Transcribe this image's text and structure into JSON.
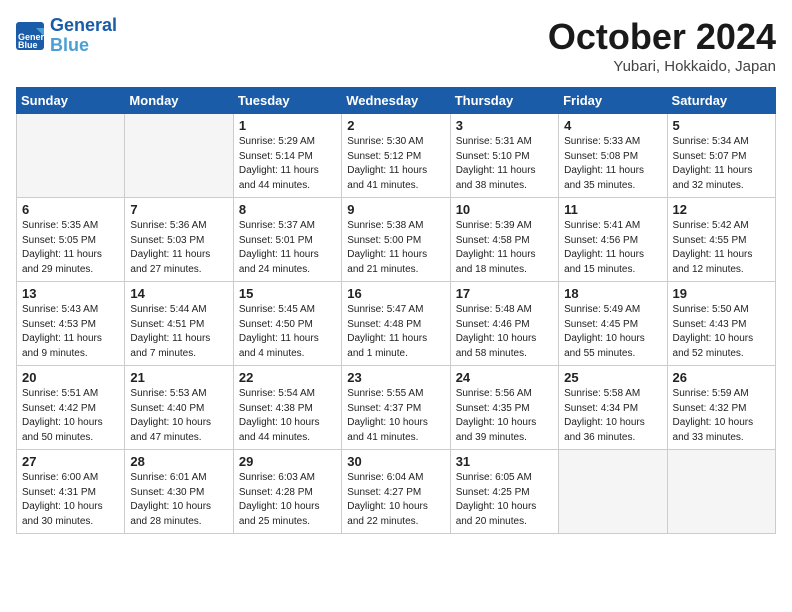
{
  "header": {
    "logo_line1": "General",
    "logo_line2": "Blue",
    "title": "October 2024",
    "subtitle": "Yubari, Hokkaido, Japan"
  },
  "weekdays": [
    "Sunday",
    "Monday",
    "Tuesday",
    "Wednesday",
    "Thursday",
    "Friday",
    "Saturday"
  ],
  "weeks": [
    [
      {
        "day": "",
        "info": ""
      },
      {
        "day": "",
        "info": ""
      },
      {
        "day": "1",
        "info": "Sunrise: 5:29 AM\nSunset: 5:14 PM\nDaylight: 11 hours\nand 44 minutes."
      },
      {
        "day": "2",
        "info": "Sunrise: 5:30 AM\nSunset: 5:12 PM\nDaylight: 11 hours\nand 41 minutes."
      },
      {
        "day": "3",
        "info": "Sunrise: 5:31 AM\nSunset: 5:10 PM\nDaylight: 11 hours\nand 38 minutes."
      },
      {
        "day": "4",
        "info": "Sunrise: 5:33 AM\nSunset: 5:08 PM\nDaylight: 11 hours\nand 35 minutes."
      },
      {
        "day": "5",
        "info": "Sunrise: 5:34 AM\nSunset: 5:07 PM\nDaylight: 11 hours\nand 32 minutes."
      }
    ],
    [
      {
        "day": "6",
        "info": "Sunrise: 5:35 AM\nSunset: 5:05 PM\nDaylight: 11 hours\nand 29 minutes."
      },
      {
        "day": "7",
        "info": "Sunrise: 5:36 AM\nSunset: 5:03 PM\nDaylight: 11 hours\nand 27 minutes."
      },
      {
        "day": "8",
        "info": "Sunrise: 5:37 AM\nSunset: 5:01 PM\nDaylight: 11 hours\nand 24 minutes."
      },
      {
        "day": "9",
        "info": "Sunrise: 5:38 AM\nSunset: 5:00 PM\nDaylight: 11 hours\nand 21 minutes."
      },
      {
        "day": "10",
        "info": "Sunrise: 5:39 AM\nSunset: 4:58 PM\nDaylight: 11 hours\nand 18 minutes."
      },
      {
        "day": "11",
        "info": "Sunrise: 5:41 AM\nSunset: 4:56 PM\nDaylight: 11 hours\nand 15 minutes."
      },
      {
        "day": "12",
        "info": "Sunrise: 5:42 AM\nSunset: 4:55 PM\nDaylight: 11 hours\nand 12 minutes."
      }
    ],
    [
      {
        "day": "13",
        "info": "Sunrise: 5:43 AM\nSunset: 4:53 PM\nDaylight: 11 hours\nand 9 minutes."
      },
      {
        "day": "14",
        "info": "Sunrise: 5:44 AM\nSunset: 4:51 PM\nDaylight: 11 hours\nand 7 minutes."
      },
      {
        "day": "15",
        "info": "Sunrise: 5:45 AM\nSunset: 4:50 PM\nDaylight: 11 hours\nand 4 minutes."
      },
      {
        "day": "16",
        "info": "Sunrise: 5:47 AM\nSunset: 4:48 PM\nDaylight: 11 hours\nand 1 minute."
      },
      {
        "day": "17",
        "info": "Sunrise: 5:48 AM\nSunset: 4:46 PM\nDaylight: 10 hours\nand 58 minutes."
      },
      {
        "day": "18",
        "info": "Sunrise: 5:49 AM\nSunset: 4:45 PM\nDaylight: 10 hours\nand 55 minutes."
      },
      {
        "day": "19",
        "info": "Sunrise: 5:50 AM\nSunset: 4:43 PM\nDaylight: 10 hours\nand 52 minutes."
      }
    ],
    [
      {
        "day": "20",
        "info": "Sunrise: 5:51 AM\nSunset: 4:42 PM\nDaylight: 10 hours\nand 50 minutes."
      },
      {
        "day": "21",
        "info": "Sunrise: 5:53 AM\nSunset: 4:40 PM\nDaylight: 10 hours\nand 47 minutes."
      },
      {
        "day": "22",
        "info": "Sunrise: 5:54 AM\nSunset: 4:38 PM\nDaylight: 10 hours\nand 44 minutes."
      },
      {
        "day": "23",
        "info": "Sunrise: 5:55 AM\nSunset: 4:37 PM\nDaylight: 10 hours\nand 41 minutes."
      },
      {
        "day": "24",
        "info": "Sunrise: 5:56 AM\nSunset: 4:35 PM\nDaylight: 10 hours\nand 39 minutes."
      },
      {
        "day": "25",
        "info": "Sunrise: 5:58 AM\nSunset: 4:34 PM\nDaylight: 10 hours\nand 36 minutes."
      },
      {
        "day": "26",
        "info": "Sunrise: 5:59 AM\nSunset: 4:32 PM\nDaylight: 10 hours\nand 33 minutes."
      }
    ],
    [
      {
        "day": "27",
        "info": "Sunrise: 6:00 AM\nSunset: 4:31 PM\nDaylight: 10 hours\nand 30 minutes."
      },
      {
        "day": "28",
        "info": "Sunrise: 6:01 AM\nSunset: 4:30 PM\nDaylight: 10 hours\nand 28 minutes."
      },
      {
        "day": "29",
        "info": "Sunrise: 6:03 AM\nSunset: 4:28 PM\nDaylight: 10 hours\nand 25 minutes."
      },
      {
        "day": "30",
        "info": "Sunrise: 6:04 AM\nSunset: 4:27 PM\nDaylight: 10 hours\nand 22 minutes."
      },
      {
        "day": "31",
        "info": "Sunrise: 6:05 AM\nSunset: 4:25 PM\nDaylight: 10 hours\nand 20 minutes."
      },
      {
        "day": "",
        "info": ""
      },
      {
        "day": "",
        "info": ""
      }
    ]
  ]
}
